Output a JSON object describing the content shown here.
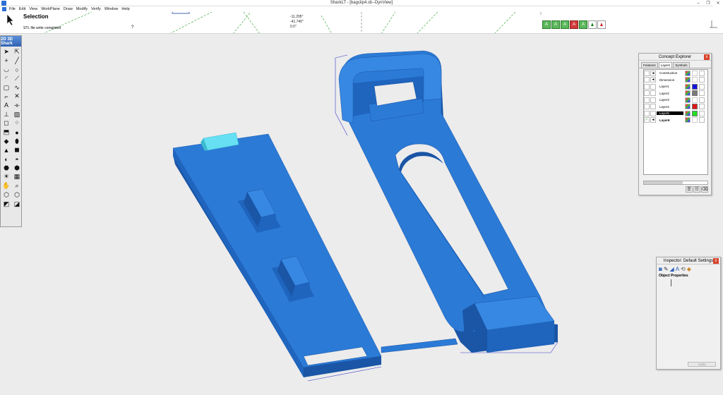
{
  "window": {
    "title": "SharkLT - [bagclip4.slt--DynView]",
    "minimize": "–",
    "restore": "❐",
    "close": "✕"
  },
  "menu": [
    "File",
    "Edit",
    "View",
    "WorkPlane",
    "Draw",
    "Modify",
    "Verify",
    "Window",
    "Help"
  ],
  "info": {
    "mode_title": "Selection",
    "status": "STL file write completed",
    "help_mark": "?",
    "coords": [
      "-11.295\"",
      "-41.740\"",
      "0.0\""
    ]
  },
  "prompt_icons": [
    {
      "name": "snap-grid-icon",
      "glyph": "A",
      "style": ""
    },
    {
      "name": "snap-grid2-icon",
      "glyph": "A",
      "style": ""
    },
    {
      "name": "snap-grid3-icon",
      "glyph": "A",
      "style": ""
    },
    {
      "name": "snap-red-icon",
      "glyph": "A",
      "style": "red"
    },
    {
      "name": "snap-green2-icon",
      "glyph": "A",
      "style": ""
    },
    {
      "name": "person-green-icon",
      "glyph": "♟",
      "style": "green"
    },
    {
      "name": "person-red-icon",
      "glyph": "♟",
      "style": "redp"
    }
  ],
  "toolbox": {
    "header": "2D 3D Shark",
    "tools": [
      {
        "name": "select-arrow-icon",
        "glyph": "➤"
      },
      {
        "name": "select-arrow2-icon",
        "glyph": "⇱"
      },
      {
        "name": "point-icon",
        "glyph": "+"
      },
      {
        "name": "line-icon",
        "glyph": "╱"
      },
      {
        "name": "arc-icon",
        "glyph": "◡"
      },
      {
        "name": "circle-icon",
        "glyph": "○"
      },
      {
        "name": "arc2-icon",
        "glyph": "◜"
      },
      {
        "name": "polyline-icon",
        "glyph": "⟋"
      },
      {
        "name": "rectangle-icon",
        "glyph": "▢"
      },
      {
        "name": "spline-icon",
        "glyph": "∿"
      },
      {
        "name": "fillet-icon",
        "glyph": "⌐"
      },
      {
        "name": "trim-icon",
        "glyph": "✕"
      },
      {
        "name": "text-icon",
        "glyph": "A"
      },
      {
        "name": "dimension-icon",
        "glyph": "⟛"
      },
      {
        "name": "ortho-icon",
        "glyph": "⊥"
      },
      {
        "name": "hatch-icon",
        "glyph": "▨"
      },
      {
        "name": "box-icon",
        "glyph": "◻"
      },
      {
        "name": "array-icon",
        "glyph": "⁘"
      },
      {
        "name": "extrude-icon",
        "glyph": "⬒"
      },
      {
        "name": "sphere-icon",
        "glyph": "●"
      },
      {
        "name": "shapes-icon",
        "glyph": "◆"
      },
      {
        "name": "cylinder-icon",
        "glyph": "⬮"
      },
      {
        "name": "loft-icon",
        "glyph": "▲"
      },
      {
        "name": "cube-icon",
        "glyph": "◼"
      },
      {
        "name": "revolve-icon",
        "glyph": "◐"
      },
      {
        "name": "shell-icon",
        "glyph": "◓"
      },
      {
        "name": "boolean-icon",
        "glyph": "⬣"
      },
      {
        "name": "fuse-icon",
        "glyph": "⬢"
      },
      {
        "name": "light-icon",
        "glyph": "☀"
      },
      {
        "name": "render-icon",
        "glyph": "▦"
      },
      {
        "name": "pan-icon",
        "glyph": "✋"
      },
      {
        "name": "zoom-icon",
        "glyph": "⌕"
      },
      {
        "name": "view-iso-icon",
        "glyph": "⬡"
      },
      {
        "name": "view-iso2-icon",
        "glyph": "⬡"
      },
      {
        "name": "view-front-icon",
        "glyph": "◩"
      },
      {
        "name": "view-top-icon",
        "glyph": "◪"
      }
    ]
  },
  "concept_explorer": {
    "title": "Concept Explorer",
    "close": "x",
    "tabs": [
      "Features",
      "Layers",
      "Symbols"
    ],
    "layers": [
      {
        "name": "Construction",
        "color": "",
        "arrow": "◄",
        "bold": false,
        "highlight": false,
        "check": ""
      },
      {
        "name": "Dimension",
        "color": "",
        "arrow": "◄",
        "bold": false,
        "highlight": false,
        "check": ""
      },
      {
        "name": "Layer1",
        "color": "#1414e0",
        "arrow": "",
        "bold": false,
        "highlight": false,
        "check": ""
      },
      {
        "name": "Layer2",
        "color": "#7a7a7a",
        "arrow": "",
        "bold": false,
        "highlight": false,
        "check": ""
      },
      {
        "name": "Layer3",
        "color": "",
        "arrow": "",
        "bold": false,
        "highlight": false,
        "check": ""
      },
      {
        "name": "Layer4",
        "color": "#e01414",
        "arrow": "",
        "bold": false,
        "highlight": false,
        "check": ""
      },
      {
        "name": "Layer5",
        "color": "#22e022",
        "arrow": "",
        "bold": false,
        "highlight": true,
        "check": ""
      },
      {
        "name": "Layer6",
        "color": "",
        "arrow": "◄",
        "bold": true,
        "highlight": false,
        "check": "✓"
      }
    ]
  },
  "inspector": {
    "title": "Inspector: Default Settings",
    "close": "x",
    "icons": [
      "camera-icon",
      "pen-icon",
      "fill-icon",
      "text-style-icon",
      "transform-icon",
      "shapes-icon"
    ],
    "icon_glyphs": [
      "◙",
      "✎",
      "◢",
      "A",
      "⟲",
      "◆"
    ],
    "section": "Object Properties",
    "apply": "Apply"
  },
  "colors": {
    "part_blue": "#2b7ad6",
    "part_dark": "#1a55a6",
    "part_side": "#1f64bd",
    "cyan_tab": "#66e0f2"
  }
}
